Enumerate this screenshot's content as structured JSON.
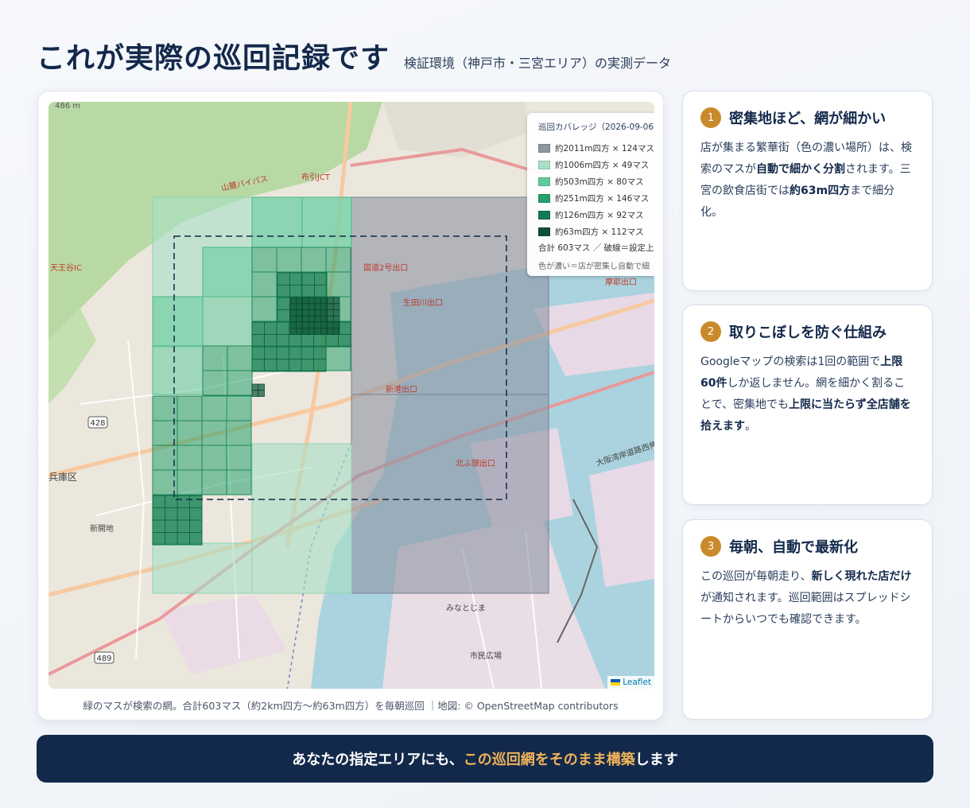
{
  "header": {
    "title": "これが実際の巡回記録です",
    "subtitle": "検証環境（神戸市・三宮エリア）の実測データ"
  },
  "map": {
    "labels": {
      "elevation": "486 m",
      "interchange_west": "天王谷IC",
      "interchange_north": "布引JCT",
      "expressway": "山麓バイパス",
      "ward": "兵庫区",
      "station_area": "新開地",
      "route_sign": "428",
      "route_sign_2": "489",
      "exit_1": "国道2号出口",
      "exit_2": "生田川出口",
      "exit_3": "新港出口",
      "exit_4": "北ふ頭出口",
      "exit_5": "摩耶出口",
      "district": "みなとじま",
      "bridge": "大阪湾岸道路西伸部",
      "park": "市民広場"
    },
    "legend": {
      "title": "巡回カバレッジ（2026-09-06",
      "items": [
        {
          "label": "約2011m四方 × 124マス",
          "color": "#8e95a3"
        },
        {
          "label": "約1006m四方 × 49マス",
          "color": "#a7e0c6"
        },
        {
          "label": "約503m四方 × 80マス",
          "color": "#5fcb9a"
        },
        {
          "label": "約251m四方 × 146マス",
          "color": "#26a06c"
        },
        {
          "label": "約126m四方 × 92マス",
          "color": "#137a4f"
        },
        {
          "label": "約63m四方 × 112マス",
          "color": "#0b5235"
        }
      ],
      "total": "合計 603マス ／ 破線＝設定上",
      "note": "色が濃い＝店が密集し自動で細"
    },
    "attribution": "Leaflet",
    "caption": "緑のマスが検索の網。合計603マス（約2km四方〜約63m四方）を毎朝巡回 ｜地図: © OpenStreetMap contributors"
  },
  "points": [
    {
      "num": "1",
      "title": "密集地ほど、網が細かい",
      "body_parts": [
        "店が集まる繁華街（色の濃い場所）は、検索のマスが",
        "自動で細かく分割",
        "されます。三宮の飲食店街では",
        "約63m四方",
        "まで細分化。"
      ]
    },
    {
      "num": "2",
      "title": "取りこぼしを防ぐ仕組み",
      "body_parts": [
        "Googleマップの検索は1回の範囲で",
        "上限60件",
        "しか返しません。網を細かく割ることで、密集地でも",
        "上限に当たらず全店舗を拾えます",
        "。"
      ]
    },
    {
      "num": "3",
      "title": "毎朝、自動で最新化",
      "body_parts": [
        "この巡回が毎朝走り、",
        "新しく現れた店だけ",
        "が通知されます。巡回範囲はスプレッドシートからいつでも確認できます。",
        "",
        ""
      ]
    }
  ],
  "cta": {
    "prefix": "あなたの指定エリアにも、",
    "highlight": "この巡回網をそのまま構築",
    "suffix": "します"
  }
}
